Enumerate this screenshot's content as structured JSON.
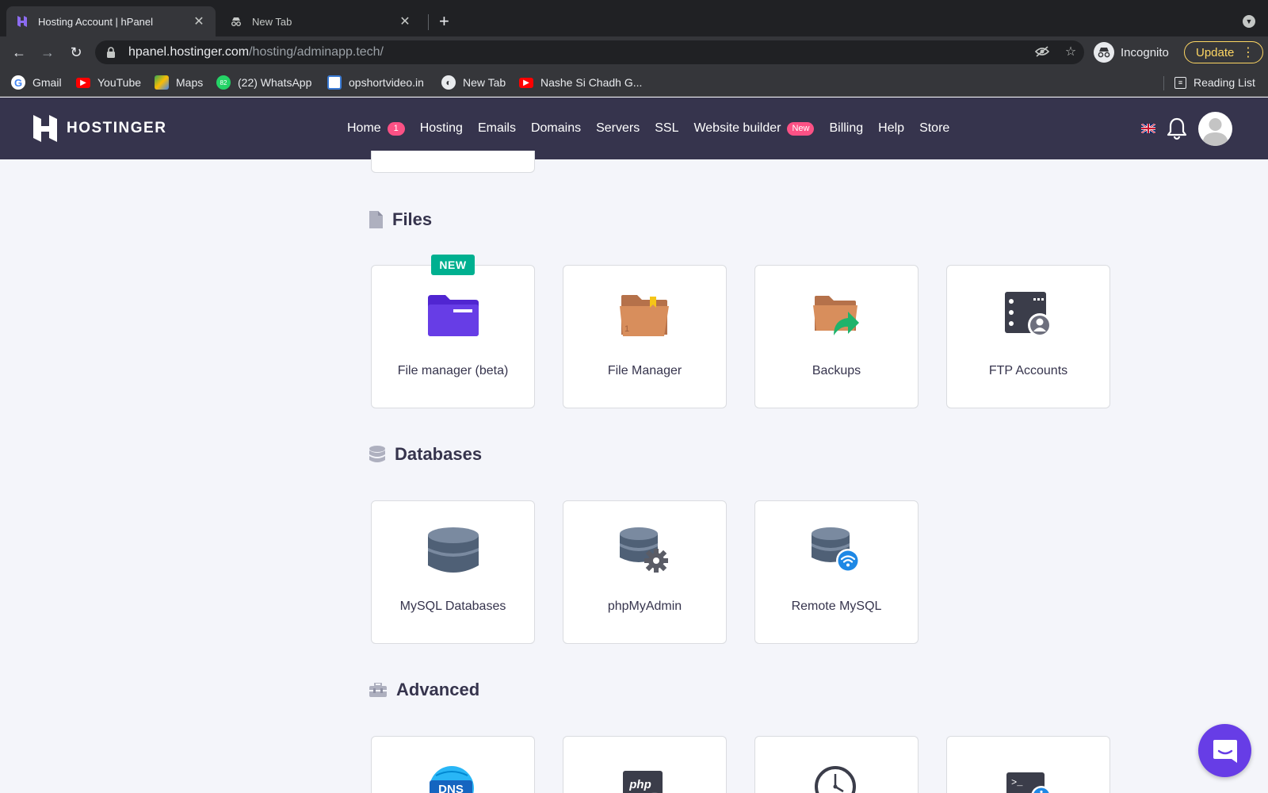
{
  "browser": {
    "tabs": [
      {
        "title": "Hosting Account | hPanel",
        "active": true,
        "icon": "hostinger-favicon"
      },
      {
        "title": "New Tab",
        "active": false,
        "icon": "incognito-icon"
      }
    ],
    "url_host": "hpanel.hostinger.com",
    "url_path": "/hosting/adminapp.tech/",
    "profile_label": "Incognito",
    "update_label": "Update",
    "bookmarks": [
      {
        "label": "Gmail",
        "icon": "google-icon"
      },
      {
        "label": "YouTube",
        "icon": "youtube-icon"
      },
      {
        "label": "Maps",
        "icon": "maps-icon"
      },
      {
        "label": "(22) WhatsApp",
        "icon": "whatsapp-icon"
      },
      {
        "label": "opshortvideo.in",
        "icon": "site-icon"
      },
      {
        "label": "New Tab",
        "icon": "globe-icon"
      },
      {
        "label": "Nashe Si Chadh G...",
        "icon": "youtube-icon"
      }
    ],
    "reading_list_label": "Reading List"
  },
  "header": {
    "brand": "HOSTINGER",
    "nav": [
      {
        "label": "Home",
        "badge": "1"
      },
      {
        "label": "Hosting"
      },
      {
        "label": "Emails"
      },
      {
        "label": "Domains"
      },
      {
        "label": "Servers"
      },
      {
        "label": "SSL"
      },
      {
        "label": "Website builder",
        "badge_new": "New"
      },
      {
        "label": "Billing"
      },
      {
        "label": "Help"
      },
      {
        "label": "Store"
      }
    ]
  },
  "sections": {
    "files": {
      "title": "Files",
      "new_tag": "NEW",
      "cards": [
        {
          "label": "File manager (beta)",
          "icon": "purple-folder-icon"
        },
        {
          "label": "File Manager",
          "icon": "folder-icon"
        },
        {
          "label": "Backups",
          "icon": "backup-folder-icon"
        },
        {
          "label": "FTP Accounts",
          "icon": "ftp-server-icon"
        }
      ]
    },
    "databases": {
      "title": "Databases",
      "cards": [
        {
          "label": "MySQL Databases",
          "icon": "database-icon"
        },
        {
          "label": "phpMyAdmin",
          "icon": "database-gear-icon"
        },
        {
          "label": "Remote MySQL",
          "icon": "database-wifi-icon"
        }
      ]
    },
    "advanced": {
      "title": "Advanced",
      "cards": [
        {
          "icon": "dns-globe-icon"
        },
        {
          "icon": "php-gear-icon"
        },
        {
          "icon": "clock-gear-icon"
        },
        {
          "icon": "terminal-info-icon"
        }
      ]
    }
  },
  "colors": {
    "header_bg": "#36344d",
    "accent_purple": "#673de6",
    "badge_pink": "#fc5185",
    "new_green": "#00b090",
    "page_bg": "#f4f5fa"
  }
}
